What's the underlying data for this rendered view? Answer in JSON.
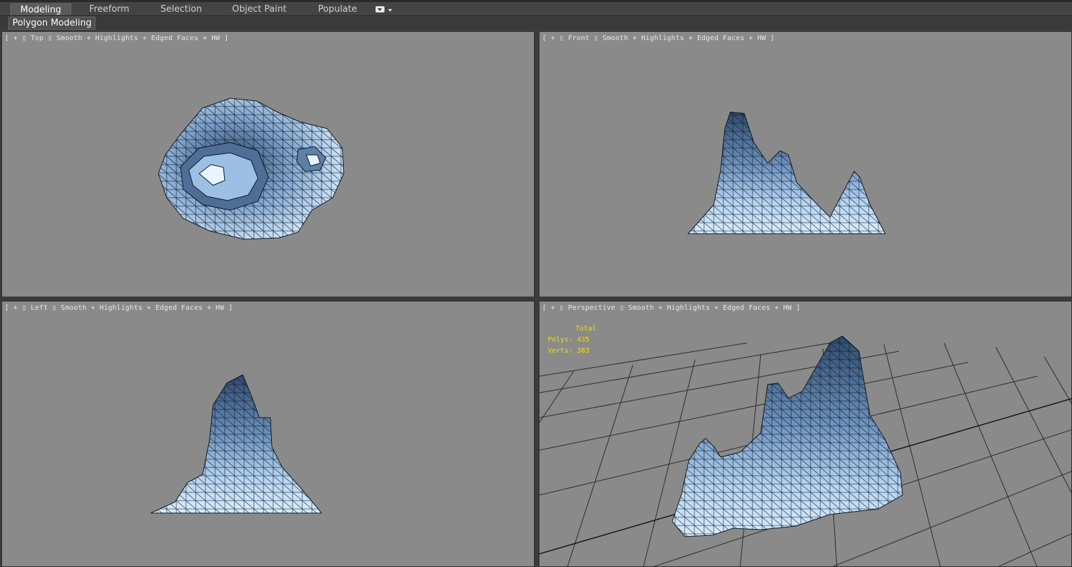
{
  "ribbon": {
    "tabs": [
      {
        "label": "Modeling",
        "active": true
      },
      {
        "label": "Freeform",
        "active": false
      },
      {
        "label": "Selection",
        "active": false
      },
      {
        "label": "Object Paint",
        "active": false
      },
      {
        "label": "Populate",
        "active": false
      }
    ],
    "more_icon": "dropdown-toggle-icon",
    "subtab": "Polygon Modeling"
  },
  "viewports": {
    "top": {
      "label": "[ + ▯ Top ▯ Smooth + Highlights + Edged Faces + HW ]"
    },
    "front": {
      "label": "[ + ▯ Front ▯ Smooth + Highlights + Edged Faces + HW ]"
    },
    "left": {
      "label": "[ + ▯ Left ▯ Smooth + Highlights + Edged Faces + HW ]"
    },
    "perspective": {
      "label": "[ + ▯ Perspective ▯ Smooth + Highlights + Edged Faces + HW ]"
    }
  },
  "stats": {
    "header": "Total",
    "polys_label": "Polys:",
    "polys": "435",
    "verts_label": "Verts:",
    "verts": "383"
  },
  "colors": {
    "viewport_bg": "#8a8a8a",
    "stats_text": "#f2e000",
    "ice_light": "#cfe6fb",
    "ice_dark": "#3f5a7c"
  }
}
